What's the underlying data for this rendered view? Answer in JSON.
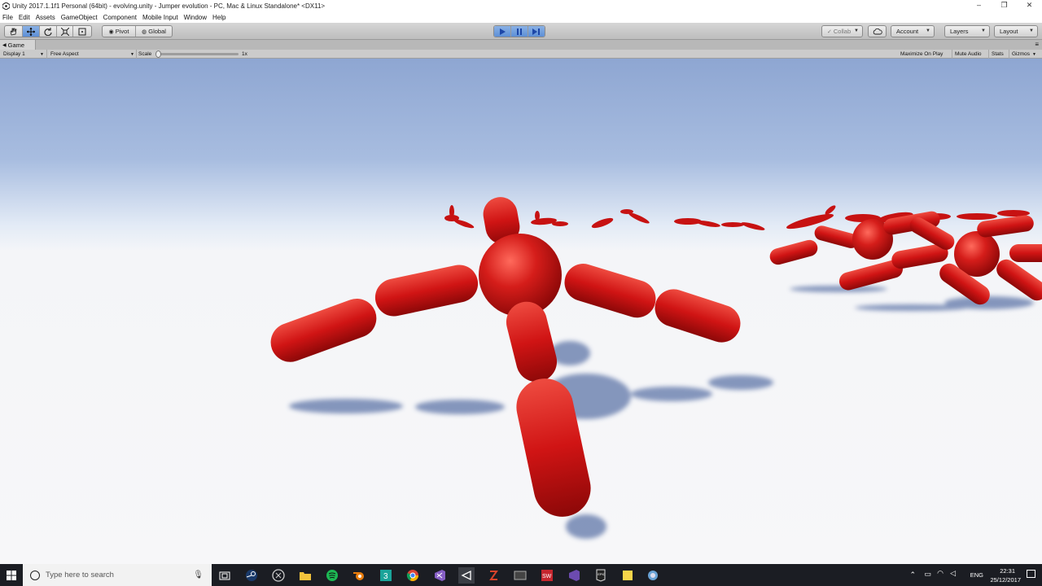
{
  "window": {
    "title": "Unity 2017.1.1f1 Personal (64bit) - evolving.unity - Jumper evolution - PC, Mac & Linux Standalone* <DX11>",
    "minimize": "–",
    "maximize": "❐",
    "close": "✕"
  },
  "menu": [
    "File",
    "Edit",
    "Assets",
    "GameObject",
    "Component",
    "Mobile Input",
    "Window",
    "Help"
  ],
  "toolbar": {
    "pivot_label": "Pivot",
    "global_label": "Global",
    "collab_label": "Collab",
    "account_label": "Account",
    "layers_label": "Layers",
    "layout_label": "Layout",
    "accent": "#5d8fd6"
  },
  "game_tab": {
    "label": "Game"
  },
  "game_bar": {
    "display": "Display 1",
    "aspect": "Free Aspect",
    "scale_label": "Scale",
    "scale_value": "1x",
    "maximize": "Maximize On Play",
    "mute": "Mute Audio",
    "stats": "Stats",
    "gizmos": "Gizmos"
  },
  "scene": {
    "creature_color": "#d01414",
    "sky_top": "#8fa8d4",
    "ground": "#f4f4f6"
  },
  "taskbar": {
    "search_placeholder": "Type here to search",
    "lang": "ENG",
    "time": "22:31",
    "date": "25/12/2017",
    "apps": [
      "task-view",
      "steam",
      "github",
      "file-explorer",
      "spotify",
      "blender",
      "app-3",
      "chrome",
      "visual-studio",
      "unity",
      "filezilla",
      "window",
      "sw-2016",
      "vs-alt",
      "epic-games",
      "notes",
      "misc"
    ]
  }
}
